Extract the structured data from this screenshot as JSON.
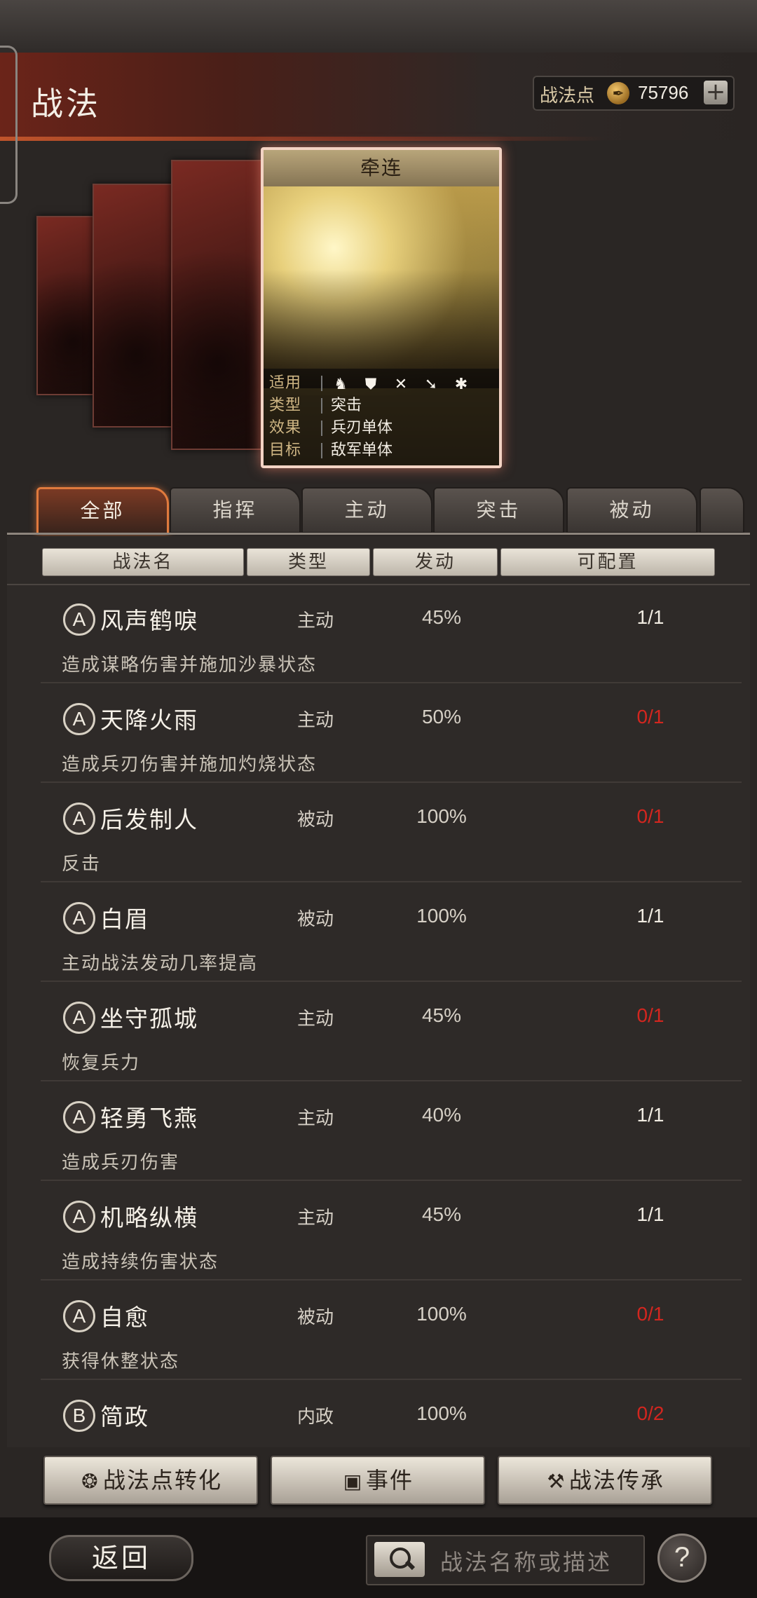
{
  "header": {
    "title": "战法",
    "points_label": "战法点",
    "points_value": "75796",
    "points_plus": "+"
  },
  "card": {
    "name": "牵连",
    "info": [
      {
        "key": "适用",
        "value": ""
      },
      {
        "key": "类型",
        "value": "突击"
      },
      {
        "key": "效果",
        "value": "兵刃单体"
      },
      {
        "key": "目标",
        "value": "敌军单体"
      }
    ],
    "unit_icons": [
      "cavalry-icon",
      "shield-icon",
      "bow-icon",
      "spear-icon",
      "siege-icon"
    ]
  },
  "tabs": [
    "全部",
    "指挥",
    "主动",
    "突击",
    "被动"
  ],
  "active_tab": "全部",
  "columns": [
    "战法名",
    "类型",
    "发动",
    "可配置"
  ],
  "skills": [
    {
      "grade": "A",
      "name": "风声鹤唳",
      "type": "主动",
      "rate": "45%",
      "config": "1/1",
      "desc": "造成谋略伤害并施加沙暴状态"
    },
    {
      "grade": "A",
      "name": "天降火雨",
      "type": "主动",
      "rate": "50%",
      "config": "0/1",
      "desc": "造成兵刃伤害并施加灼烧状态"
    },
    {
      "grade": "A",
      "name": "后发制人",
      "type": "被动",
      "rate": "100%",
      "config": "0/1",
      "desc": "反击"
    },
    {
      "grade": "A",
      "name": "白眉",
      "type": "被动",
      "rate": "100%",
      "config": "1/1",
      "desc": "主动战法发动几率提高"
    },
    {
      "grade": "A",
      "name": "坐守孤城",
      "type": "主动",
      "rate": "45%",
      "config": "0/1",
      "desc": "恢复兵力"
    },
    {
      "grade": "A",
      "name": "轻勇飞燕",
      "type": "主动",
      "rate": "40%",
      "config": "1/1",
      "desc": "造成兵刃伤害"
    },
    {
      "grade": "A",
      "name": "机略纵横",
      "type": "主动",
      "rate": "45%",
      "config": "1/1",
      "desc": "造成持续伤害状态"
    },
    {
      "grade": "A",
      "name": "自愈",
      "type": "被动",
      "rate": "100%",
      "config": "0/1",
      "desc": "获得休整状态"
    },
    {
      "grade": "B",
      "name": "简政",
      "type": "内政",
      "rate": "100%",
      "config": "0/2",
      "desc": ""
    }
  ],
  "buttons": {
    "convert": "战法点转化",
    "events": "事件",
    "inherit": "战法传承"
  },
  "footer": {
    "back": "返回",
    "search_placeholder": "战法名称或描述",
    "help": "?"
  },
  "colors": {
    "accent": "#e07a3d",
    "unavailable": "#d3261f",
    "header_red": "#6b2419"
  }
}
